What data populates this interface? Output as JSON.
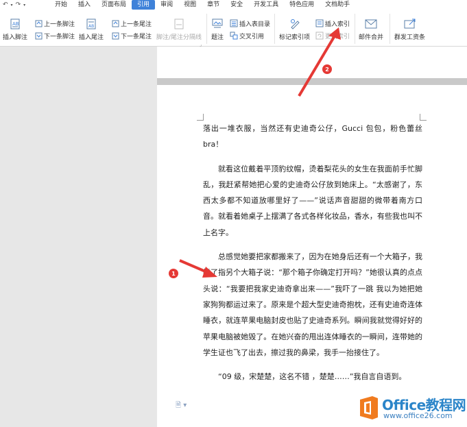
{
  "menubar": {
    "items": [
      "开始",
      "插入",
      "页面布局",
      "引用",
      "审阅",
      "视图",
      "章节",
      "安全",
      "开发工具",
      "特色应用",
      "文档助手"
    ],
    "active_index": 3
  },
  "ribbon": {
    "insert_footnote": "插入脚注",
    "prev_footnote": "上一条脚注",
    "next_footnote": "下一条脚注",
    "insert_endnote": "插入尾注",
    "prev_endnote": "上一条尾注",
    "next_endnote": "下一条尾注",
    "footnote_separator": "脚注/尾注分隔线",
    "caption": "题注",
    "insert_table_of_figures": "插入表目录",
    "cross_reference": "交叉引用",
    "mark_index_entry": "标记索引项",
    "insert_index": "插入索引",
    "update_index": "更新索引",
    "mail_merge": "邮件合并",
    "group_send_payroll": "群发工资条"
  },
  "document": {
    "paragraphs": [
      "落出一堆衣服，当然还有史迪奇公仔，Gucci 包包，粉色蕾丝bra！",
      "就看这位戴着平顶豹纹帽，烫着梨花头的女生在我面前手忙脚乱，我赶紧帮她把心爱的史迪奇公仔放到她床上。“太感谢了，东西太多都不知道放哪里好了——”说话声音甜甜的微带着南方口音。就看着她桌子上摆满了各式各样化妆品，香水，有些我也叫不上名字。",
      "总感觉她要把家都搬来了，因为在她身后还有一个大箱子，我指了指另个大箱子说：“那个箱子你确定打开吗？”她很认真的点点头说：“我要把我家史迪奇拿出来——”我吓了一跳 我以为她把她家狗狗都运过来了。原来是个超大型史迪奇抱枕，还有史迪奇连体睡衣，就连苹果电脑封皮也贴了史迪奇系列。瞬间我就觉得好好的苹果电脑被她毁了。在她兴奋的甩出连体睡衣的一瞬间，连带她的学生证也飞了出去，擦过我的鼻梁，我手一抬接住了。",
      "“09 级，宋楚楚，这名不错 ，楚楚……”我自言自语到。"
    ]
  },
  "annotations": {
    "badge1": "1",
    "badge2": "2"
  },
  "watermark": {
    "text": "Office教程网",
    "url": "www.office26.com"
  },
  "colors": {
    "accent": "#3f82d9",
    "annotation_red": "#e53935",
    "watermark_orange": "#f07b1f",
    "watermark_blue": "#2b85c9"
  }
}
